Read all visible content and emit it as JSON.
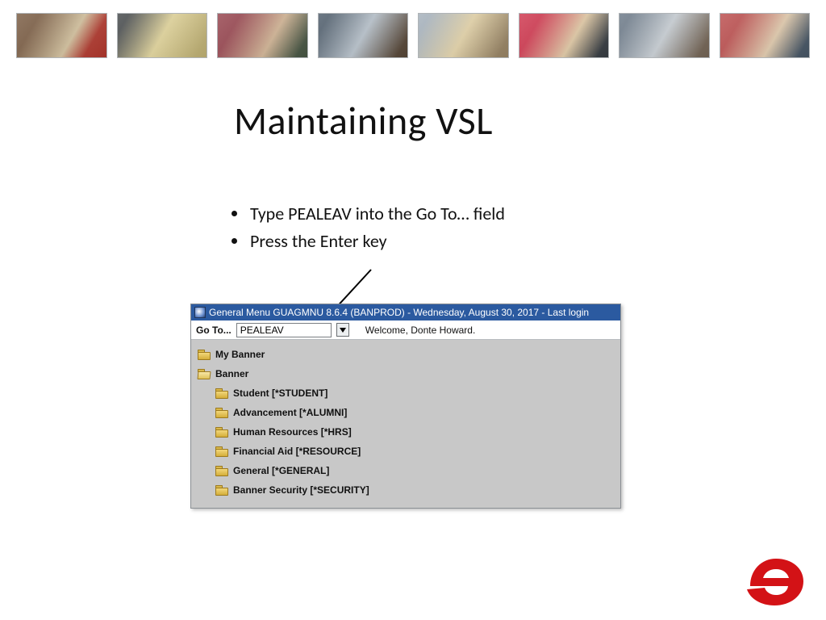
{
  "title": "Maintaining VSL",
  "bullets": [
    "Type PEALEAV into the Go To… field",
    "Press the Enter key"
  ],
  "app": {
    "titlebar": "General Menu  GUAGMNU  8.6.4  (BANPROD) - Wednesday, August 30, 2017 - Last login",
    "go_label": "Go To...",
    "go_value": "PEALEAV",
    "welcome": "Welcome, Donte Howard.",
    "tree": {
      "root1": "My Banner",
      "root2": "Banner",
      "children": [
        "Student [*STUDENT]",
        "Advancement [*ALUMNI]",
        "Human Resources [*HRS]",
        "Financial Aid [*RESOURCE]",
        "General [*GENERAL]",
        "Banner Security [*SECURITY]"
      ]
    }
  }
}
